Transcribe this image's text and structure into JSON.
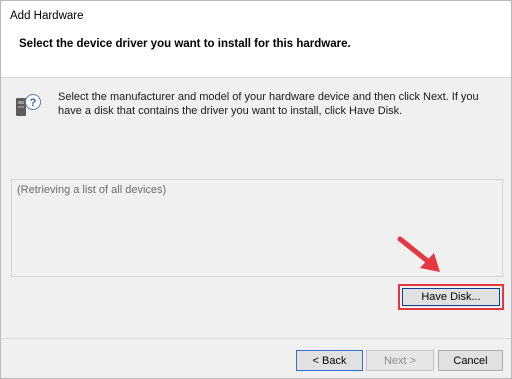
{
  "window": {
    "title": "Add Hardware",
    "subtitle": "Select the device driver you want to install for this hardware."
  },
  "content": {
    "instructions": "Select the manufacturer and model of your hardware device and then click Next. If you have a disk that contains the driver you want to install, click Have Disk.",
    "device_list_placeholder": "(Retrieving a list of all devices)",
    "icon": "hardware-help-icon"
  },
  "buttons": {
    "have_disk": "Have Disk...",
    "back": "< Back",
    "next": "Next >",
    "cancel": "Cancel"
  },
  "annotation": {
    "arrow_color": "#e53740",
    "highlight_color": "#e53740"
  }
}
